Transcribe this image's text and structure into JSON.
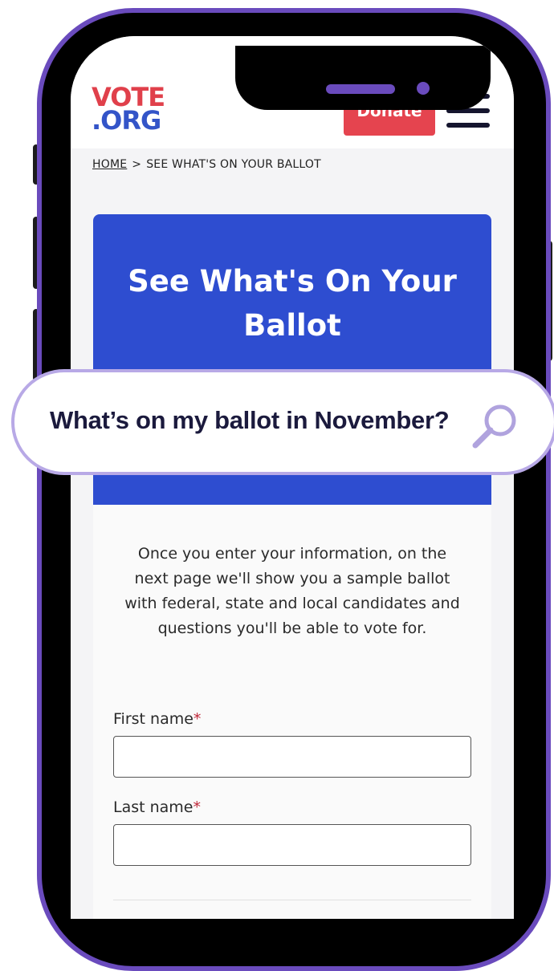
{
  "header": {
    "logo_line1": "VOTE",
    "logo_line2": ".ORG",
    "donate_label": "Donate"
  },
  "breadcrumb": {
    "home": "HOME",
    "separator": ">",
    "current": "SEE WHAT'S ON YOUR BALLOT"
  },
  "hero": {
    "title_line1": "See What's On Your",
    "title_line2": "Ballot"
  },
  "search": {
    "text": "What’s on my ballot in November?"
  },
  "intro": {
    "text": "Once you enter your information, on the next page we'll show you a sample ballot with federal, state and local candidates and questions you'll be able to vote for."
  },
  "form": {
    "first_name_label": "First name",
    "last_name_label": "Last name",
    "required_marker": "*"
  },
  "colors": {
    "frame": "#6a4bbd",
    "hero": "#2e4dd0",
    "donate": "#e5444f",
    "logo_red": "#e0404b",
    "logo_blue": "#3354c8"
  },
  "icons": [
    "search-icon",
    "hamburger-menu-icon"
  ]
}
